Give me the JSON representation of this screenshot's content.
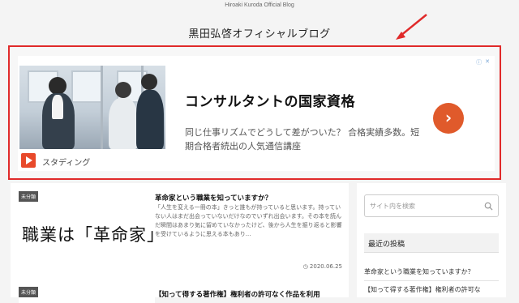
{
  "header": {
    "tagline": "Hiroaki Kuroda Official Blog",
    "title": "黒田弘啓オフィシャルブログ"
  },
  "annotation": {
    "color": "#e02a2a"
  },
  "ad": {
    "badge_icons": [
      "info-icon",
      "close-icon"
    ],
    "brand": "スタディング",
    "headline": "コンサルタントの国家資格",
    "description": "同じ仕事リズムでどうして差がついた？ 合格実績多数。短期合格者続出の人気通信講座",
    "cta_icon": "chevron-right-icon",
    "cta_glyph": "›",
    "cta_color": "#e05a2b"
  },
  "posts": [
    {
      "category": "未分類",
      "thumb_text": "職業は「革命家」",
      "title": "革命家という職業を知っていますか？",
      "excerpt": "「人生を変える一冊の本」きっと誰もが持っていると思います。持っていない人はまだ出会っていないだけなのでいずれ出会います。その本を読んだ瞬間はあまり気に留めていなかったけど、後から人生を振り返ると影響を受けているように思える本もあり...",
      "date": "2020.06.25"
    },
    {
      "category": "未分類",
      "title": "【知って得する著作権】権利者の許可なく作品を利用"
    }
  ],
  "sidebar": {
    "search_placeholder": "サイト内を検索",
    "recent_heading": "最近の投稿",
    "recent_posts": [
      "革命家という職業を知っていますか？",
      "【知って得する著作権】権利者の許可な"
    ]
  }
}
